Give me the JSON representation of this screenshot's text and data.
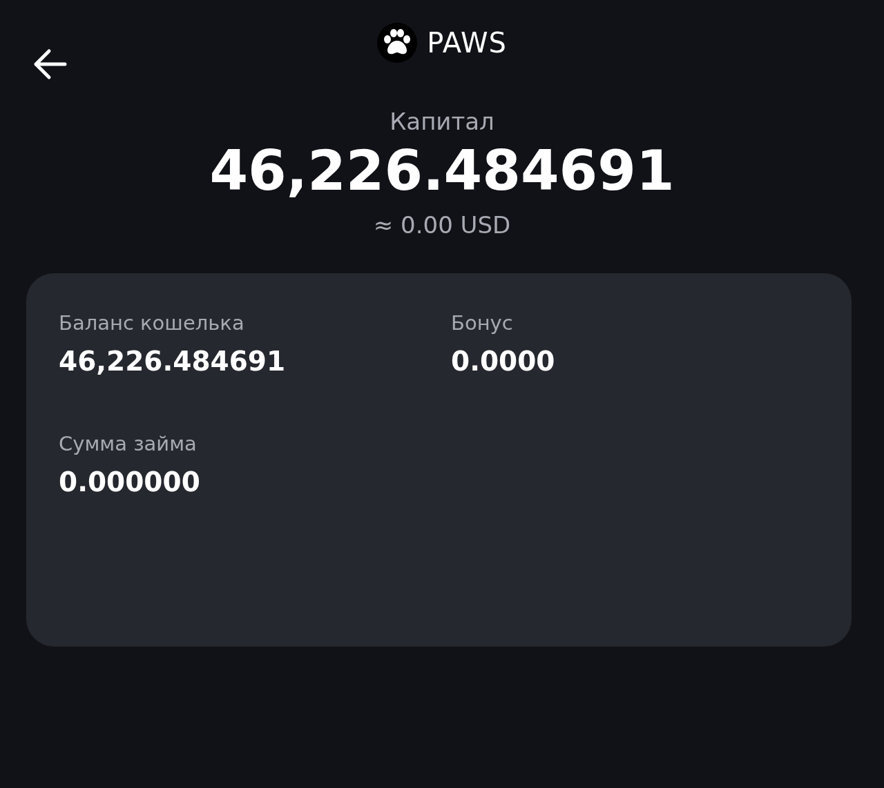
{
  "header": {
    "title": "PAWS"
  },
  "capital": {
    "label": "Капитал",
    "amount": "46,226.484691",
    "converted": "≈ 0.00 USD"
  },
  "details": [
    {
      "label": "Баланс кошелька",
      "value": "46,226.484691"
    },
    {
      "label": "Бонус",
      "value": "0.0000"
    },
    {
      "label": "Сумма займа",
      "value": "0.000000"
    }
  ]
}
